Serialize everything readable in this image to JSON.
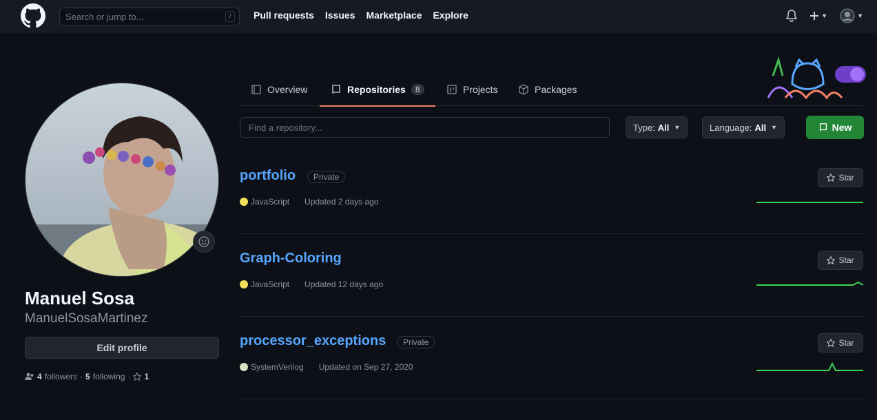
{
  "header": {
    "search_placeholder": "Search or jump to...",
    "search_shortcut": "/",
    "nav": [
      "Pull requests",
      "Issues",
      "Marketplace",
      "Explore"
    ]
  },
  "profile": {
    "name": "Manuel Sosa",
    "username": "ManuelSosaMartinez",
    "edit_label": "Edit profile",
    "followers_count": "4",
    "followers_label": "followers",
    "following_count": "5",
    "following_label": "following",
    "stars_count": "1"
  },
  "tabs": [
    {
      "label": "Overview"
    },
    {
      "label": "Repositories",
      "count": "8"
    },
    {
      "label": "Projects"
    },
    {
      "label": "Packages"
    }
  ],
  "filters": {
    "find_placeholder": "Find a repository...",
    "type_label": "Type:",
    "type_value": "All",
    "language_label": "Language:",
    "language_value": "All",
    "new_label": "New"
  },
  "repos": [
    {
      "name": "portfolio",
      "visibility": "Private",
      "language": "JavaScript",
      "language_color": "#f1e05a",
      "updated": "Updated 2 days ago",
      "star_label": "Star"
    },
    {
      "name": "Graph-Coloring",
      "visibility": "",
      "language": "JavaScript",
      "language_color": "#f1e05a",
      "updated": "Updated 12 days ago",
      "star_label": "Star"
    },
    {
      "name": "processor_exceptions",
      "visibility": "Private",
      "language": "SystemVerilog",
      "language_color": "#dae1c2",
      "updated": "Updated on Sep 27, 2020",
      "star_label": "Star"
    }
  ],
  "colors": {
    "accent_tab": "#f78166",
    "link": "#58a6ff",
    "new_button": "#238636"
  }
}
